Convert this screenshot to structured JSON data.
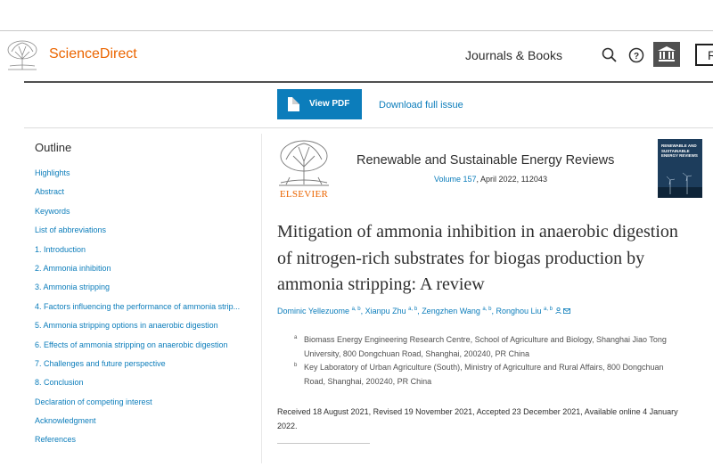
{
  "header": {
    "brand": "ScienceDirect",
    "nav_journals": "Journals & Books",
    "register_partial": "R"
  },
  "toolbar": {
    "view_pdf": "View PDF",
    "download_issue": "Download full issue"
  },
  "outline": {
    "title": "Outline",
    "items": [
      "Highlights",
      "Abstract",
      "Keywords",
      "List of abbreviations",
      "1. Introduction",
      "2. Ammonia inhibition",
      "3. Ammonia stripping",
      "4. Factors influencing the performance of ammonia strip...",
      "5. Ammonia stripping options in anaerobic digestion",
      "6. Effects of ammonia stripping on anaerobic digestion",
      "7. Challenges and future perspective",
      "8. Conclusion",
      "Declaration of competing interest",
      "Acknowledgment",
      "References"
    ]
  },
  "journal": {
    "publisher": "ELSEVIER",
    "title": "Renewable and Sustainable Energy Reviews",
    "volume_link": "Volume 157",
    "volume_rest": ", April 2022, 112043",
    "cover_text": "RENEWABLE AND SUSTAINABLE ENERGY REVIEWS"
  },
  "article": {
    "title": "Mitigation of ammonia inhibition in anaerobic digestion of nitrogen-rich substrates for biogas production by ammonia stripping: A review",
    "authors": [
      {
        "name": "Dominic Yellezuome",
        "sup": "a, b"
      },
      {
        "name": "Xianpu Zhu",
        "sup": "a, b"
      },
      {
        "name": "Zengzhen Wang",
        "sup": "a, b"
      },
      {
        "name": "Ronghou Liu",
        "sup": "a, b"
      }
    ],
    "affiliations": [
      {
        "label": "a",
        "text": "Biomass Energy Engineering Research Centre, School of Agriculture and Biology, Shanghai Jiao Tong University, 800 Dongchuan Road, Shanghai, 200240, PR China"
      },
      {
        "label": "b",
        "text": "Key Laboratory of Urban Agriculture (South), Ministry of Agriculture and Rural Affairs, 800 Dongchuan Road, Shanghai, 200240, PR China"
      }
    ],
    "dates": "Received 18 August 2021, Revised 19 November 2021, Accepted 23 December 2021, Available online 4 January 2022."
  },
  "colors": {
    "brand_orange": "#eb6500",
    "link_blue": "#0c7dbb",
    "text_dark": "#2e2e2e"
  }
}
